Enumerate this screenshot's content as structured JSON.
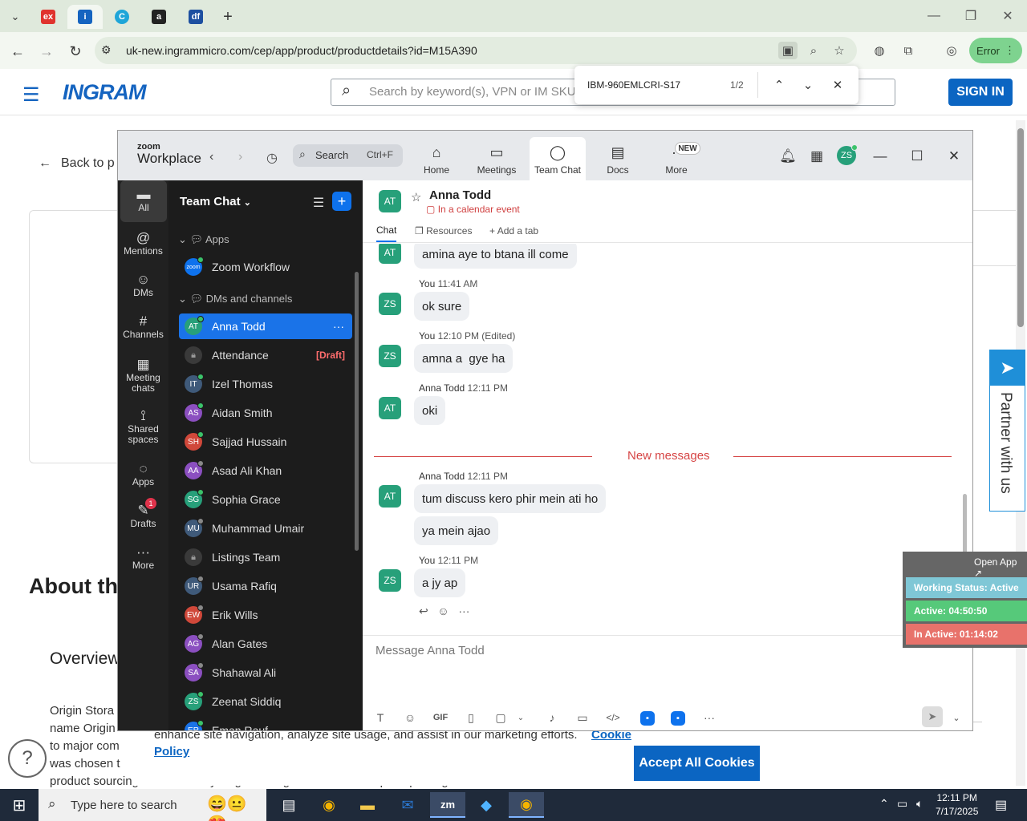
{
  "browser": {
    "tabs": [
      {
        "icon": "ex",
        "color": "#e0332e"
      },
      {
        "icon": "ingram",
        "color": "#1564c0",
        "active": true
      },
      {
        "icon": "C",
        "color": "#1ea5d8"
      },
      {
        "icon": "a",
        "color": "#222222"
      },
      {
        "icon": "df",
        "color": "#1d4fa0"
      }
    ],
    "url": "uk-new.ingrammicro.com/cep/app/product/productdetails?id=M15A390",
    "error_label": "Error"
  },
  "find": {
    "term": "IBM-960EMLCRI-S17",
    "count": "1/2"
  },
  "site": {
    "logo": "INGRAM",
    "search_placeholder": "Search by keyword(s), VPN or IM SKU",
    "signin": "SIGN IN",
    "back": "Back to p",
    "about": "About thi",
    "overview": "Overview",
    "body_lines": [
      "Origin Stora",
      "name Origin",
      "to major com",
      "was chosen t"
    ],
    "body_tail": "product sourcing and assembly.Origin Storage is now the complete package",
    "cookie_text": "enhance site navigation, analyze site usage, and assist in our marketing efforts.",
    "cookie_link": "Cookie",
    "cookie_link2": "Policy",
    "accept": "Accept All Cookies",
    "partner": "Partner with us"
  },
  "status_widget": {
    "open_app": "Open App ↗",
    "working": "Working Status: Active",
    "active": "Active: 04:50:50",
    "inactive": "In Active: 01:14:02",
    "colors": {
      "working": "#7fc7d6",
      "active": "#56c97a",
      "inactive": "#e8726b"
    }
  },
  "zoom": {
    "logo_small": "zoom",
    "logo_big": "Workplace",
    "search": "Search",
    "search_key": "Ctrl+F",
    "tabs": [
      {
        "label": "Home",
        "icon": "⌂"
      },
      {
        "label": "Meetings",
        "icon": "▭"
      },
      {
        "label": "Team Chat",
        "icon": "◯",
        "active": true
      },
      {
        "label": "Docs",
        "icon": "▤"
      },
      {
        "label": "More",
        "icon": "···"
      }
    ],
    "new_badge": "NEW",
    "avatar": "ZS",
    "rail": [
      {
        "label": "All",
        "icon": "▬",
        "active": true
      },
      {
        "label": "Mentions",
        "icon": "@"
      },
      {
        "label": "DMs",
        "icon": "☺"
      },
      {
        "label": "Channels",
        "icon": "#"
      },
      {
        "label": "Meeting chats",
        "icon": "▦"
      },
      {
        "label": "Shared spaces",
        "icon": "⟟"
      },
      {
        "label": "Apps",
        "icon": "◌"
      },
      {
        "label": "Drafts",
        "icon": "✎"
      },
      {
        "label": "More",
        "icon": "···"
      }
    ],
    "drafts_badge": "1",
    "panel": {
      "title": "Team Chat",
      "sect_apps": "Apps",
      "zoom_workflow": "Zoom Workflow",
      "sect_dms": "DMs and channels",
      "draft_label": "[Draft]",
      "contacts": [
        {
          "name": "Anna Todd",
          "initials": "AT",
          "color": "#27a07a",
          "selected": true
        },
        {
          "name": "Attendance",
          "initials": "",
          "color": "#3a3a3a",
          "lock": true,
          "draft": true
        },
        {
          "name": "Izel Thomas",
          "initials": "IT",
          "color": "#3f5a7a"
        },
        {
          "name": "Aidan Smith",
          "initials": "AS",
          "color": "#8b4fc0"
        },
        {
          "name": "Sajjad Hussain",
          "initials": "SH",
          "color": "#d0483a"
        },
        {
          "name": "Asad Ali Khan",
          "initials": "AA",
          "color": "#8b4fc0"
        },
        {
          "name": "Sophia Grace",
          "initials": "SG",
          "color": "#27a07a"
        },
        {
          "name": "Muhammad Umair",
          "initials": "MU",
          "color": "#3f5a7a"
        },
        {
          "name": "Listings Team",
          "initials": "",
          "color": "#3a3a3a",
          "lock": true
        },
        {
          "name": "Usama Rafiq",
          "initials": "UR",
          "color": "#3f5a7a"
        },
        {
          "name": "Erik Wills",
          "initials": "EW",
          "color": "#d0483a"
        },
        {
          "name": "Alan Gates",
          "initials": "AG",
          "color": "#8b4fc0"
        },
        {
          "name": "Shahawal Ali",
          "initials": "SA",
          "color": "#8b4fc0"
        },
        {
          "name": "Zeenat Siddiq",
          "initials": "ZS",
          "color": "#27a07a"
        },
        {
          "name": "Eman Rauf",
          "initials": "ER",
          "color": "#1a73e8"
        }
      ]
    },
    "chat": {
      "avatar": "AT",
      "name": "Anna Todd",
      "status": "In a calendar event",
      "tab_chat": "Chat",
      "tab_resources": "Resources",
      "tab_add": "Add a tab",
      "new_messages": "New messages",
      "messages": [
        {
          "avatar": "AT",
          "author": "",
          "time": "",
          "text": "amina aye to btana ill come"
        },
        {
          "avatar": "ZS",
          "author": "You",
          "time": "11:41 AM",
          "text": "ok sure"
        },
        {
          "avatar": "ZS",
          "author": "You",
          "time": "12:10 PM (Edited)",
          "text": "amna a  gye ha"
        },
        {
          "avatar": "AT",
          "author": "Anna Todd",
          "time": "12:11 PM",
          "text": "oki"
        },
        {
          "avatar": "AT",
          "author": "Anna Todd",
          "time": "12:11 PM",
          "text": "tum discuss kero phir mein ati ho"
        },
        {
          "avatar": "",
          "author": "",
          "time": "",
          "text": "ya mein ajao"
        },
        {
          "avatar": "ZS",
          "author": "You",
          "time": "12:11 PM",
          "text": "a jy ap"
        }
      ],
      "composer_placeholder": "Message Anna Todd",
      "gif": "GIF"
    }
  },
  "taskbar": {
    "search_placeholder": "Type here to search",
    "time": "12:11 PM",
    "date": "7/17/2025"
  }
}
